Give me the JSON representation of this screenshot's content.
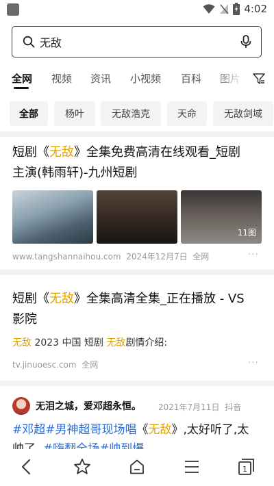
{
  "status_bar": {
    "time": "4:02"
  },
  "search": {
    "query": "无敌",
    "placeholder": ""
  },
  "tabs": [
    {
      "label": "全网",
      "active": true
    },
    {
      "label": "视频"
    },
    {
      "label": "资讯"
    },
    {
      "label": "小视频"
    },
    {
      "label": "百科"
    },
    {
      "label": "图片"
    }
  ],
  "chips": [
    {
      "label": "全部",
      "active": true
    },
    {
      "label": "杨叶"
    },
    {
      "label": "无敌浩克"
    },
    {
      "label": "天命"
    },
    {
      "label": "无敌剑域"
    }
  ],
  "results": [
    {
      "title_line1_prefix": "短剧《",
      "title_highlight": "无敌",
      "title_line1_suffix": "》全集免费高清在线观看_短剧",
      "title_line2": "主演(韩雨轩)-九州短剧",
      "image_count_label": "11图",
      "source": "www.tangshannaihou.com",
      "date": "2024年12月7日",
      "scope": "全网",
      "more": "···"
    },
    {
      "title_line1_prefix": "短剧《",
      "title_highlight": "无敌",
      "title_line1_suffix": "》全集高清全集_正在播放 - VS",
      "title_line2": "影院",
      "snippet_hl1": "无敌",
      "snippet_mid": " 2023 中国 短剧 ",
      "snippet_hl2": "无敌",
      "snippet_end": "剧情介绍:",
      "source": "tv.jinuoesc.com",
      "scope": "全网",
      "more": "···"
    },
    {
      "author": "无泪之城，爱邓超永恒。",
      "date": "2021年7月11日",
      "platform": "抖音",
      "tag1": "#邓超",
      "tag2": "#男神超哥现场唱",
      "text_prefix": "《",
      "text_highlight": "无敌",
      "text_suffix": "》,太好听了,太",
      "line2_start": "帅了",
      "tag3": "#嗨翻全场",
      "tag4": "#帅到爆",
      "more": "···"
    }
  ],
  "bottom_nav": [
    {
      "icon": "back-icon"
    },
    {
      "icon": "star-icon"
    },
    {
      "icon": "home-icon"
    },
    {
      "icon": "menu-icon"
    },
    {
      "icon": "tabs-icon",
      "count": "1"
    }
  ],
  "colors": {
    "highlight": "#e4a400",
    "hashtag": "#2f6fd8",
    "meta": "#9a9a9a"
  }
}
